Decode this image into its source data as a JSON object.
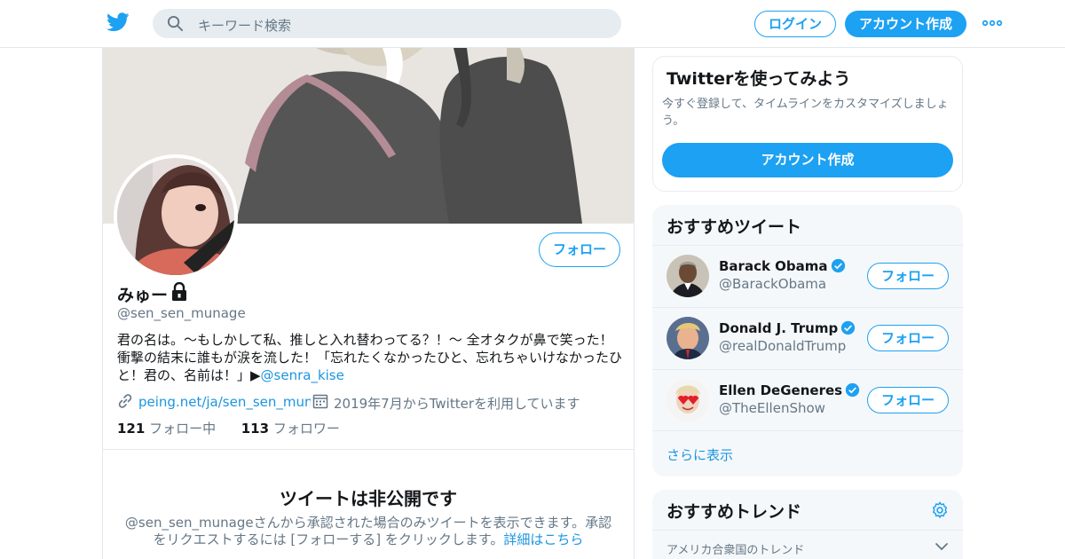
{
  "header": {
    "search_placeholder": "キーワード検索",
    "login_label": "ログイン",
    "signup_label": "アカウント作成"
  },
  "profile": {
    "name": "みゅー",
    "handle": "@sen_sen_munage",
    "bio_text": "君の名は。〜もしかして私、推しと入れ替わってる？！〜 全オタクが鼻で笑った！衝撃の結末に誰もが涙を流した！「忘れたくなかったひと、忘れちゃいけなかったひと！君の、名前は！」▶",
    "bio_mention": "@senra_kise",
    "link": "peing.net/ja/sen_sen_mun…",
    "joined": "2019年7月からTwitterを利用しています",
    "following_count": "121",
    "following_label": "フォロー中",
    "followers_count": "113",
    "followers_label": "フォロワー",
    "follow_label": "フォロー",
    "protected_title": "ツイートは非公開です",
    "protected_text": "@sen_sen_munageさんから承認された場合のみツイートを表示できます。承認をリクエストするには [フォローする] をクリックします。",
    "protected_link": "詳細はこちら"
  },
  "try_card": {
    "title": "Twitterを使ってみよう",
    "text": "今すぐ登録して、タイムラインをカスタマイズしましょう。",
    "button": "アカウント作成"
  },
  "recommended": {
    "title": "おすすめツイート",
    "items": [
      {
        "name": "Barack Obama",
        "handle": "@BarackObama",
        "follow": "フォロー"
      },
      {
        "name": "Donald J. Trump",
        "handle": "@realDonaldTrump",
        "follow": "フォロー"
      },
      {
        "name": "Ellen DeGeneres",
        "handle": "@TheEllenShow",
        "follow": "フォロー"
      }
    ],
    "show_more": "さらに表示"
  },
  "trends": {
    "title": "おすすめトレンド",
    "subtitle": "アメリカ合衆国のトレンド"
  },
  "colors": {
    "accent": "#1da1f2",
    "link": "#1b95e0",
    "muted": "#657786"
  },
  "icons": [
    "twitter-logo-icon",
    "search-icon",
    "more-icon",
    "lock-icon",
    "link-icon",
    "calendar-icon",
    "verified-icon",
    "gear-icon",
    "chevron-down-icon"
  ]
}
